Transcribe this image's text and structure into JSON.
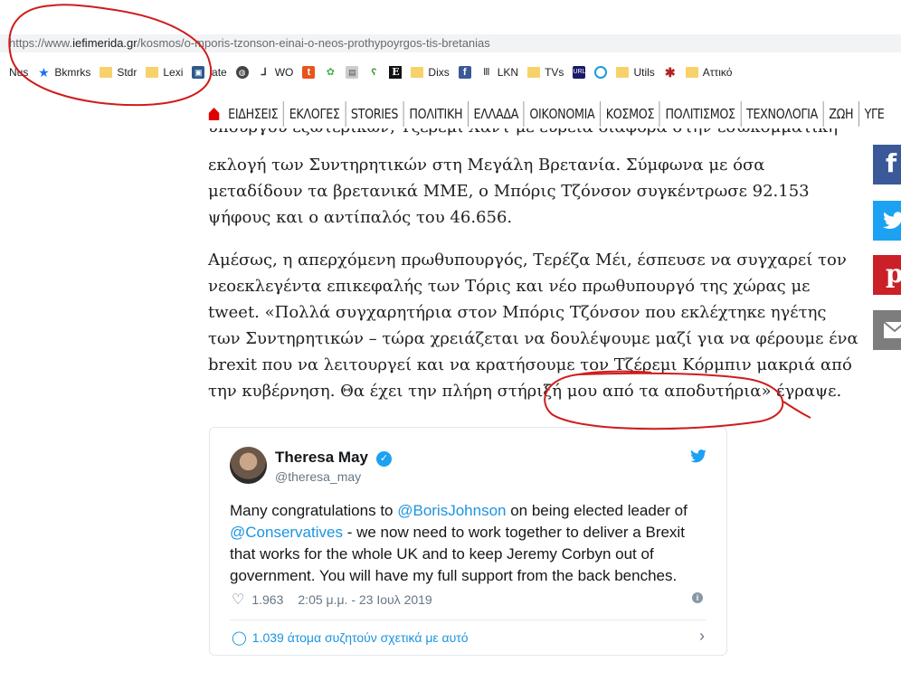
{
  "browser": {
    "url_prefix": "https://www.",
    "url_domain": "iefimerida.gr",
    "url_path": "/kosmos/o-mporis-tzonson-einai-o-neos-prothypoyrgos-tis-bretanias"
  },
  "bookmarks": [
    {
      "label": "Nus",
      "icon": "none"
    },
    {
      "label": "Bkmrks",
      "icon": "star-icon"
    },
    {
      "label": "Stdr",
      "icon": "folder-icon"
    },
    {
      "label": "Lexi",
      "icon": "folder-icon"
    },
    {
      "label": "iate",
      "icon": "gift-icon"
    },
    {
      "label": "",
      "icon": "globe-icon"
    },
    {
      "label": "WO",
      "icon": "wo-icon"
    },
    {
      "label": "",
      "icon": "t-icon"
    },
    {
      "label": "",
      "icon": "frog-icon"
    },
    {
      "label": "",
      "icon": "printer-icon"
    },
    {
      "label": "",
      "icon": "snake-icon"
    },
    {
      "label": "",
      "icon": "e-icon"
    },
    {
      "label": "Dixs",
      "icon": "folder-icon"
    },
    {
      "label": "",
      "icon": "facebook-icon"
    },
    {
      "label": "LKN",
      "icon": "columns-icon"
    },
    {
      "label": "TVs",
      "icon": "folder-icon"
    },
    {
      "label": "",
      "icon": "tinyurl-icon"
    },
    {
      "label": "",
      "icon": "circle-icon"
    },
    {
      "label": "Utils",
      "icon": "folder-icon"
    },
    {
      "label": "",
      "icon": "asterisk-icon"
    },
    {
      "label": "Αττικό",
      "icon": "folder-icon"
    }
  ],
  "site_nav": {
    "items": [
      "ΕΙΔΗΣΕΙΣ",
      "ΕΚΛΟΓΕΣ",
      "STORIES",
      "ΠΟΛΙΤΙΚΗ",
      "ΕΛΛΑΔΑ",
      "ΟΙΚΟΝΟΜΙΑ",
      "ΚΟΣΜΟΣ",
      "ΠΟΛΙΤΙΣΜΟΣ",
      "ΤΕΧΝΟΛΟΓΙΑ",
      "ΖΩΗ",
      "ΥΓΕ"
    ]
  },
  "article": {
    "partial_line": "υπουργού εξωτερικών, Τζέρεμι Χαντ με ευρεία διαφορά στην εσωκομματική",
    "p1_rest": "εκλογή των Συντηρητικών στη Μεγάλη Βρετανία. Σύμφωνα με όσα μεταδίδουν τα βρετανικά ΜΜΕ, ο Μπόρις Τζόνσον συγκέντρωσε 92.153 ψήφους και ο αντίπαλός του 46.656.",
    "p2": "Αμέσως, η απερχόμενη πρωθυπουργός, Τερέζα Μέι, έσπευσε να συγχαρεί τον νεοεκλεγέντα επικεφαλής των Τόρις και νέο πρωθυπουργό της χώρας με tweet. «Πολλά συγχαρητήρια στον Μπόρις Τζόνσον που εκλέχτηκε ηγέτης των Συντηρητικών – τώρα χρειάζεται να δουλέψουμε μαζί για να φέρουμε ένα brexit που να λειτουργεί και να κρατήσουμε τον Τζέρεμι Κόρμπιν μακριά από την κυβέρνηση. Θα έχει την πλήρη στήριξή μου από τα αποδυτήρια» έγραψε."
  },
  "tweet": {
    "name": "Theresa May",
    "handle": "@theresa_may",
    "text_1": "Many congratulations to ",
    "mention_1": "@BorisJohnson",
    "text_2": " on being elected leader of ",
    "mention_2": "@Conservatives",
    "text_3": " - we now need to work together to deliver a Brexit that works for the whole UK and to keep Jeremy Corbyn out of government. You will have my full support from the back benches.",
    "likes": "1.963",
    "time": "2:05 μ.μ. - 23 Ιουλ 2019",
    "footer": "1.039 άτομα συζητούν σχετικά με αυτό"
  },
  "colors": {
    "facebook": "#3b5998",
    "twitter": "#1da1f2",
    "pinterest": "#cb2027",
    "email": "#7d7d7d",
    "annotation": "#d01c1c",
    "home": "#e00000"
  }
}
